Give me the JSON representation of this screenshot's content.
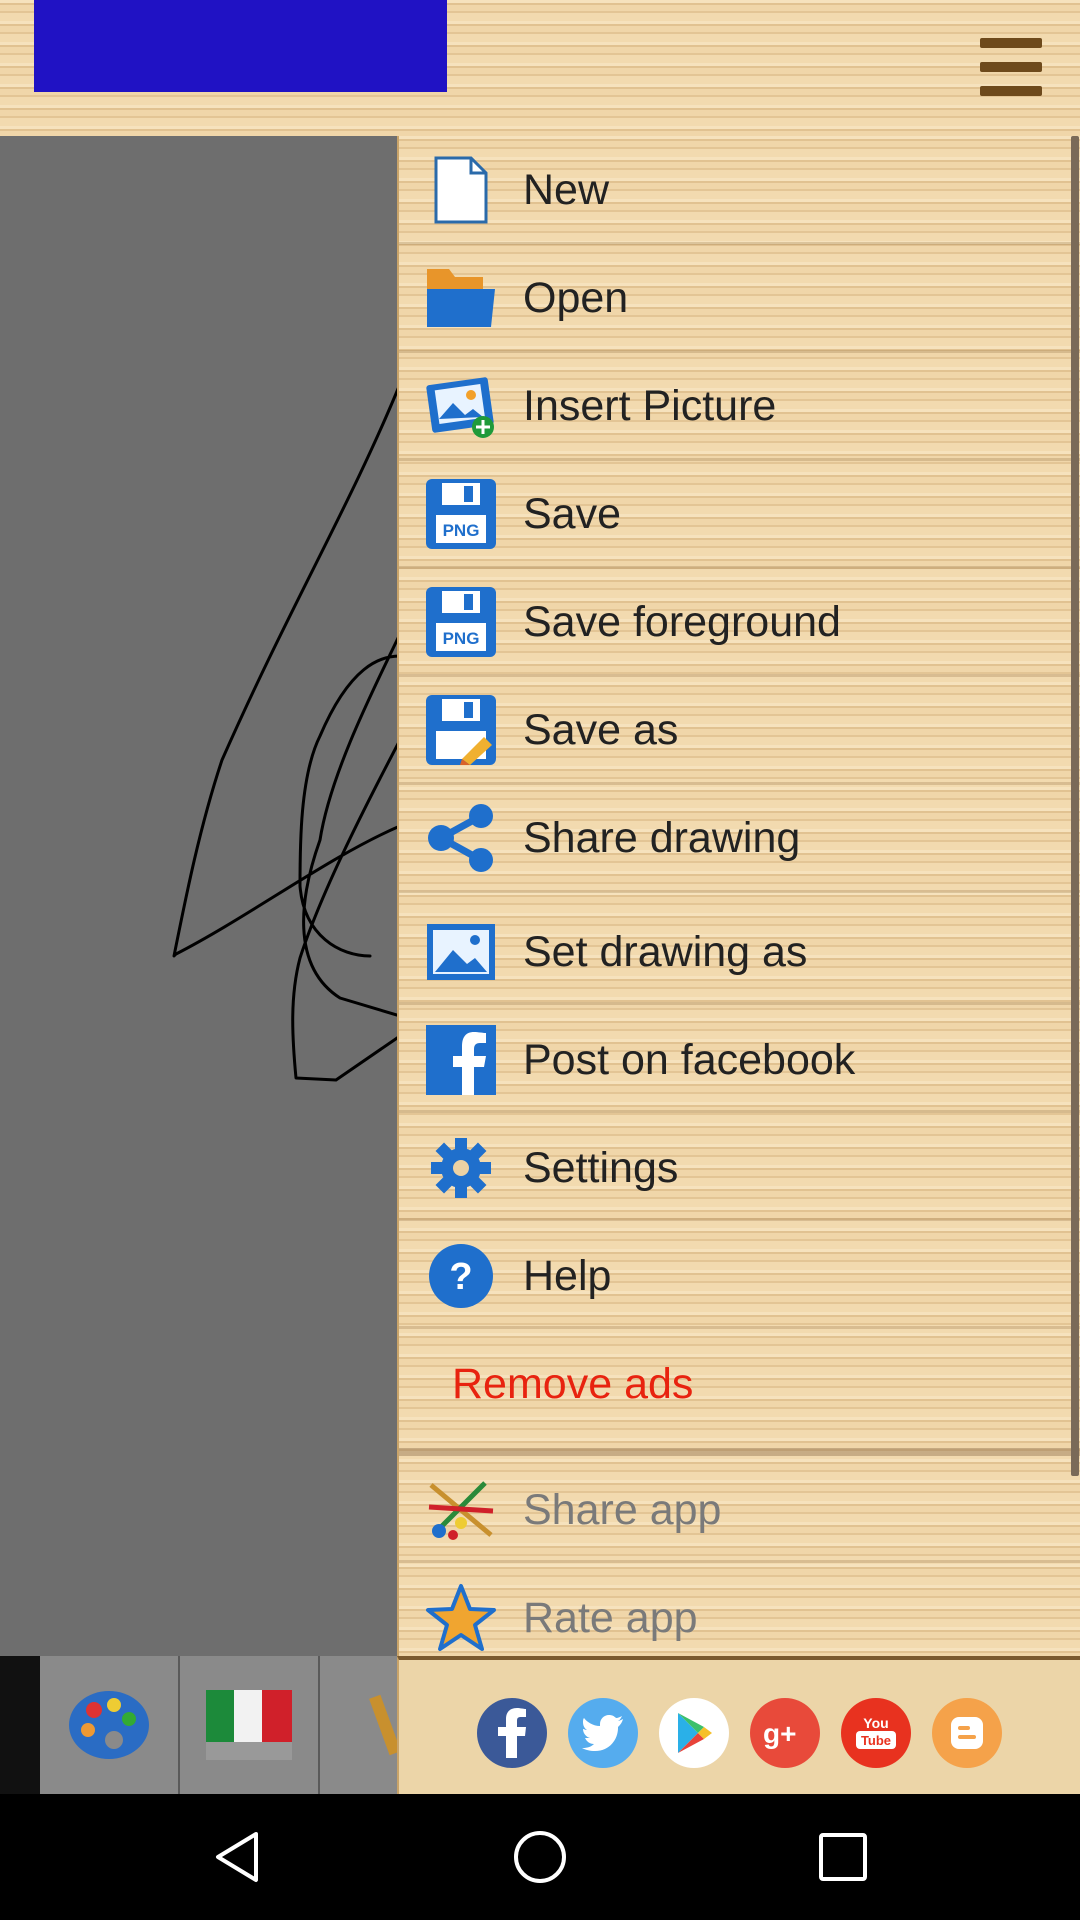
{
  "top_bar": {
    "menu_icon": "hamburger-menu-icon",
    "banner_color": "#2012c4"
  },
  "drawer": {
    "items": [
      {
        "label": "New",
        "icon": "new-file-icon"
      },
      {
        "label": "Open",
        "icon": "folder-icon"
      },
      {
        "label": "Insert Picture",
        "icon": "insert-picture-icon"
      },
      {
        "label": "Save",
        "icon": "save-png-icon",
        "badge": "PNG"
      },
      {
        "label": "Save foreground",
        "icon": "save-foreground-png-icon",
        "badge": "PNG"
      },
      {
        "label": "Save as",
        "icon": "save-as-icon"
      },
      {
        "label": "Share drawing",
        "icon": "share-icon"
      },
      {
        "label": "Set drawing as",
        "icon": "wallpaper-icon"
      },
      {
        "label": "Post on facebook",
        "icon": "facebook-icon"
      },
      {
        "label": "Settings",
        "icon": "gear-icon"
      },
      {
        "label": "Help",
        "icon": "help-icon"
      },
      {
        "label": "Remove ads"
      },
      {
        "label": "Share app",
        "icon": "share-app-icon"
      },
      {
        "label": "Rate app",
        "icon": "star-icon"
      }
    ]
  },
  "social": [
    {
      "name": "facebook",
      "color": "#3b5998"
    },
    {
      "name": "twitter",
      "color": "#55acee"
    },
    {
      "name": "google-play",
      "color": "#ffffff"
    },
    {
      "name": "google-plus",
      "color": "#e84a3a"
    },
    {
      "name": "youtube",
      "color": "#e8321f"
    },
    {
      "name": "blogger",
      "color": "#f5a24a"
    }
  ],
  "colors": {
    "accent_blue": "#2a7ac4",
    "remove_ads_red": "#e8230f"
  }
}
